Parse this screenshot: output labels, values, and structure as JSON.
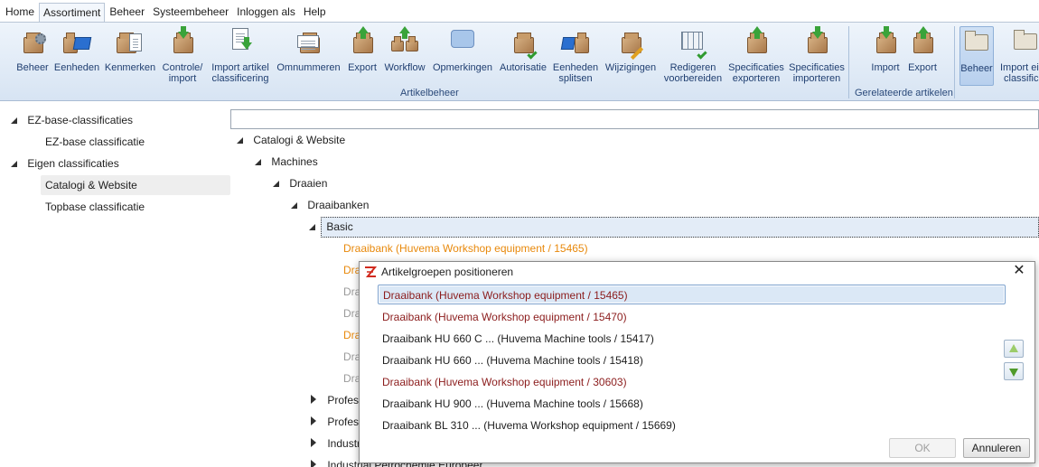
{
  "menu": {
    "items": [
      "Home",
      "Assortiment",
      "Beheer",
      "Systeembeheer",
      "Inloggen als",
      "Help"
    ]
  },
  "ribbon": {
    "buttons": [
      {
        "l1": "Beheer",
        "l2": ""
      },
      {
        "l1": "Eenheden",
        "l2": ""
      },
      {
        "l1": "Kenmerken",
        "l2": ""
      },
      {
        "l1": "Controle/",
        "l2": "import"
      },
      {
        "l1": "Import artikel",
        "l2": "classificering"
      },
      {
        "l1": "Omnummeren",
        "l2": ""
      },
      {
        "l1": "Export",
        "l2": ""
      },
      {
        "l1": "Workflow",
        "l2": ""
      },
      {
        "l1": "Opmerkingen",
        "l2": ""
      },
      {
        "l1": "Autorisatie",
        "l2": ""
      },
      {
        "l1": "Eenheden",
        "l2": "splitsen"
      },
      {
        "l1": "Wijzigingen",
        "l2": ""
      },
      {
        "l1": "Redigeren",
        "l2": "voorbereiden"
      },
      {
        "l1": "Specificaties",
        "l2": "exporteren"
      },
      {
        "l1": "Specificaties",
        "l2": "importeren"
      },
      {
        "l1": "Import",
        "l2": ""
      },
      {
        "l1": "Export",
        "l2": ""
      },
      {
        "l1": "Beheer",
        "l2": ""
      },
      {
        "l1": "Import ei",
        "l2": "classifica"
      }
    ],
    "groups": [
      "Artikelbeheer",
      "Gerelateerde artikelen"
    ]
  },
  "left_tree": {
    "items": [
      "EZ-base-classificaties",
      "EZ-base classificatie",
      "Eigen classificaties",
      "Catalogi & Website",
      "Topbase classificatie"
    ]
  },
  "right_tree": {
    "search_value": "",
    "nodes": {
      "catalogi": "Catalogi & Website",
      "machines": "Machines",
      "draaien": "Draaien",
      "draaibanken": "Draaibanken",
      "basic": "Basic",
      "child1": "Draaibank (Huvema Workshop equipment / 15465)",
      "child2": "Dra",
      "child3": "Dra",
      "child4": "Dra",
      "child5": "Dra",
      "child6": "Dra",
      "child7": "Dra",
      "prof1": "Profess",
      "prof2": "Profess",
      "indus1": "Industr",
      "indus2": "Industrial Petrochemie Europeer"
    }
  },
  "dialog": {
    "title": "Artikelgroepen positioneren",
    "items": [
      "Draaibank (Huvema Workshop equipment / 15465)",
      "Draaibank (Huvema Workshop equipment / 15470)",
      "Draaibank HU 660 C ... (Huvema Machine tools / 15417)",
      "Draaibank HU 660 ... (Huvema Machine tools / 15418)",
      "Draaibank (Huvema Workshop equipment / 30603)",
      "Draaibank HU 900 ... (Huvema Machine tools / 15668)",
      "Draaibank BL 310 ... (Huvema Workshop equipment / 15669)"
    ],
    "ok_label": "OK",
    "cancel_label": "Annuleren"
  },
  "colors": {
    "accent_orange": "#e8890c",
    "dark_red_text": "#8b1c1c",
    "ribbon_text": "#1f3e70",
    "selection": "#dbe8f6"
  }
}
